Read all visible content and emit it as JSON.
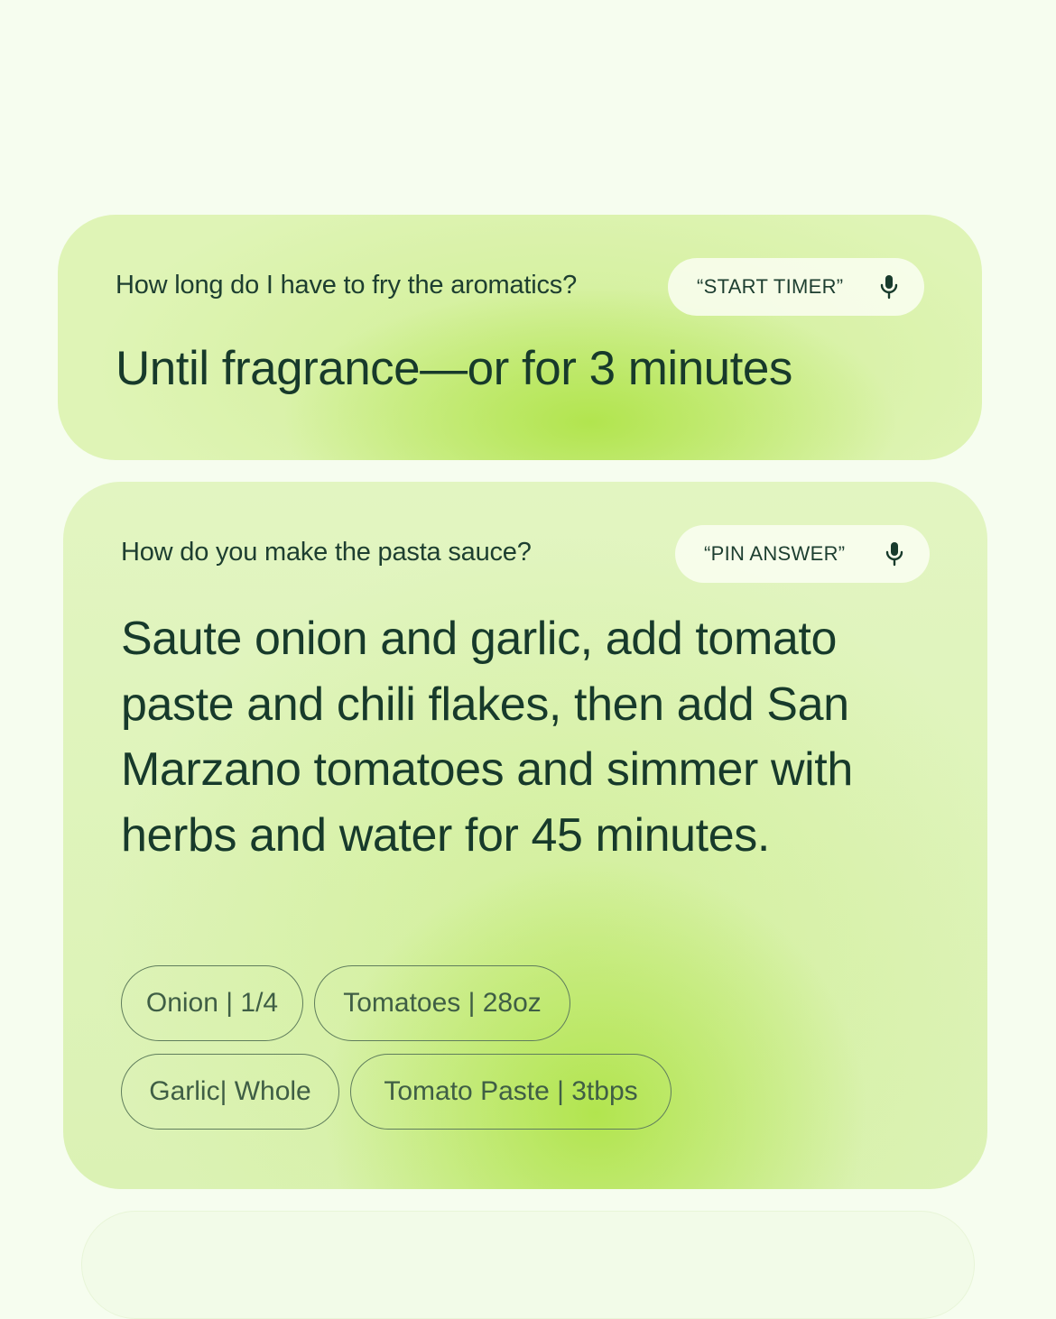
{
  "cards": [
    {
      "question": "How long do I have to fry the aromatics?",
      "action_label": "“START TIMER”",
      "action_icon": "mic-icon",
      "answer": "Until fragrance—or for 3 minutes"
    },
    {
      "question": "How do you make the pasta sauce?",
      "action_label": "“PIN ANSWER”",
      "action_icon": "mic-icon",
      "answer": "Saute onion and garlic, add tomato paste and chili flakes, then add San Marzano tomatoes and simmer with herbs and water for 45 minutes.",
      "ingredients": [
        "Onion | 1/4",
        "Tomatoes | 28oz",
        "Garlic| Whole",
        "Tomato Paste | 3tbps"
      ]
    }
  ],
  "colors": {
    "background": "#f6fdef",
    "card_base": "#dff4b6",
    "card_glow": "#b0e44a",
    "text_primary": "#173a2b",
    "chip_border": "#5f7d5c"
  }
}
